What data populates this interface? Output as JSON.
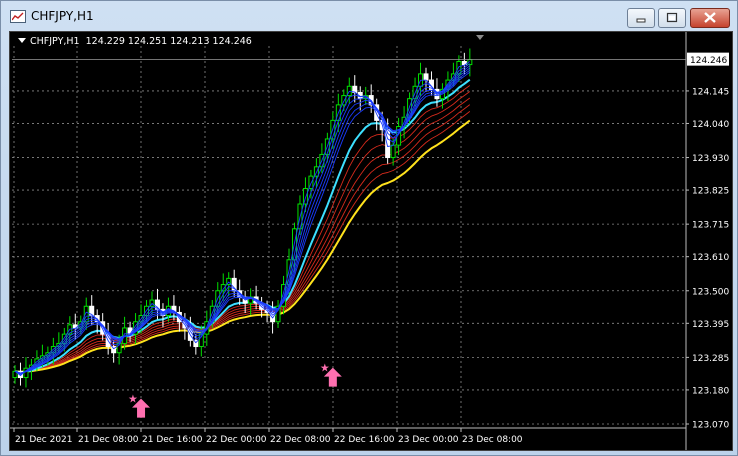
{
  "window": {
    "title": "CHFJPY,H1",
    "buttons": {
      "minimize": "minimize-icon",
      "maximize": "maximize-icon",
      "close": "close-icon"
    }
  },
  "chart_header": {
    "symbol": "CHFJPY,H1",
    "ohlc": "124.229 124.251 124.213 124.246"
  },
  "chart_data": {
    "type": "candlestick",
    "symbol": "CHFJPY",
    "timeframe": "H1",
    "ylim": [
      123.07,
      124.29
    ],
    "y_ticks": [
      "124.145",
      "124.040",
      "123.930",
      "123.825",
      "123.715",
      "123.610",
      "123.500",
      "123.395",
      "123.285",
      "123.180",
      "123.070"
    ],
    "current_price": "124.246",
    "x_ticks": [
      "21 Dec 2021",
      "21 Dec 08:00",
      "21 Dec 16:00",
      "22 Dec 00:00",
      "22 Dec 08:00",
      "22 Dec 16:00",
      "23 Dec 00:00",
      "23 Dec 08:00"
    ],
    "grid": true,
    "colors": {
      "background": "#000000",
      "grid": "#8a8a8a",
      "bull": "#00e000",
      "bear": "#ffffff",
      "fast_ribbon": "#1a3cff",
      "fast_edge": "#ffffff",
      "slow_ribbon": "#d42a1c",
      "cyan_ma": "#3de0ff",
      "yellow_ma": "#ffe21c",
      "arrow": "#ff6fb0"
    },
    "closes": [
      123.24,
      123.22,
      123.25,
      123.26,
      123.28,
      123.29,
      123.3,
      123.32,
      123.33,
      123.36,
      123.39,
      123.38,
      123.4,
      123.45,
      123.42,
      123.4,
      123.36,
      123.32,
      123.3,
      123.33,
      123.38,
      123.36,
      123.4,
      123.42,
      123.45,
      123.47,
      123.44,
      123.42,
      123.45,
      123.43,
      123.4,
      123.38,
      123.34,
      123.32,
      123.36,
      123.4,
      123.45,
      123.5,
      123.52,
      123.54,
      123.5,
      123.48,
      123.46,
      123.48,
      123.46,
      123.44,
      123.43,
      123.4,
      123.45,
      123.52,
      123.6,
      123.7,
      123.78,
      123.83,
      123.87,
      123.9,
      123.94,
      123.99,
      124.05,
      124.1,
      124.13,
      124.16,
      124.14,
      124.12,
      124.13,
      124.1,
      124.05,
      124.02,
      123.93,
      123.97,
      124.03,
      124.06,
      124.12,
      124.16,
      124.2,
      124.18,
      124.15,
      124.12,
      124.15,
      124.18,
      124.2,
      124.24,
      124.23,
      124.246
    ],
    "signal_arrows": [
      {
        "index": 23,
        "price": 123.21
      },
      {
        "index": 58,
        "price": 123.31
      }
    ]
  }
}
